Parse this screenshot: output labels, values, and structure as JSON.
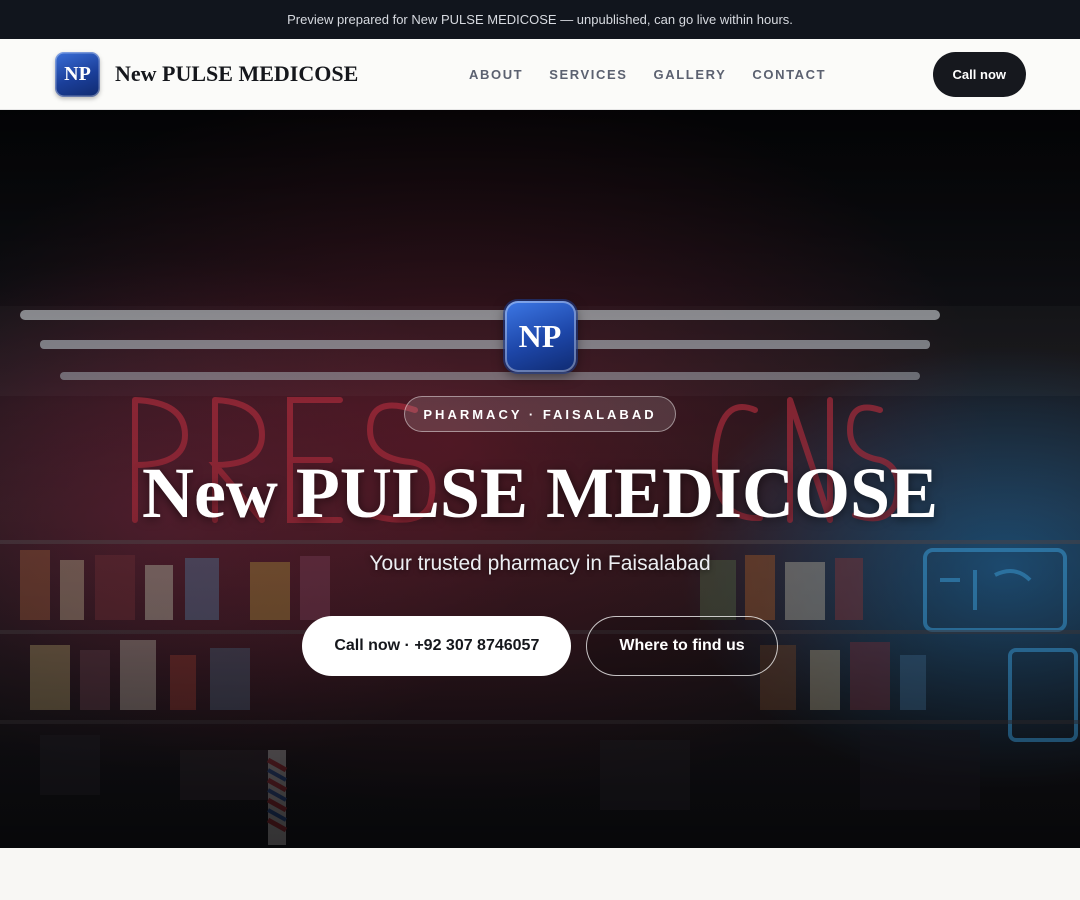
{
  "announcement": "Preview prepared for New PULSE MEDICOSE — unpublished, can go live within hours.",
  "header": {
    "logo_initials": "NP",
    "brand_name": "New PULSE MEDICOSE",
    "nav": [
      "ABOUT",
      "SERVICES",
      "GALLERY",
      "CONTACT"
    ],
    "cta_label": "Call now"
  },
  "hero": {
    "logo_initials": "NP",
    "tag": "PHARMACY · FAISALABAD",
    "title": "New PULSE MEDICOSE",
    "subtitle": "Your trusted pharmacy in Faisalabad",
    "primary_button": "Call now · +92 307 8746057",
    "secondary_button": "Where to find us",
    "background_image": "night pharmacy storefront with red and blue neon signs"
  },
  "colors": {
    "topbar": "#11151d",
    "brand_blue": "#1d46a8",
    "dark_button": "#16181e",
    "page_bg": "#f8f7f4"
  }
}
